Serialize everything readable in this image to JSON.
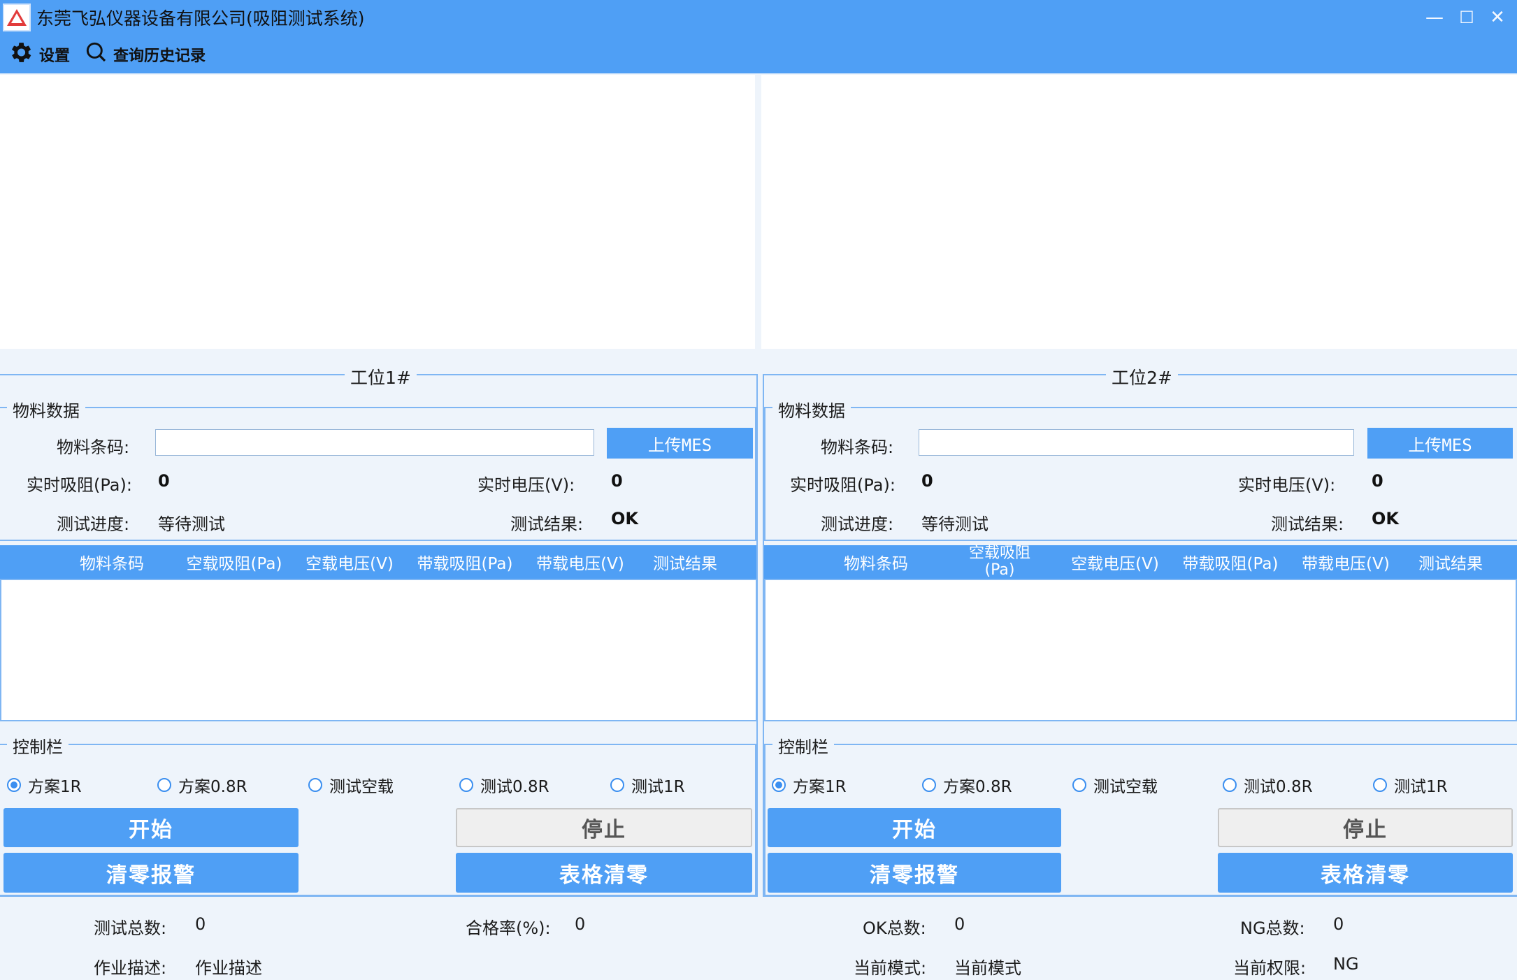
{
  "window": {
    "title": "东莞飞弘仪器设备有限公司(吸阻测试系统)",
    "minimize": "—",
    "maximize": "☐",
    "close": "✕"
  },
  "menu": [
    {
      "label": "设置",
      "icon": "gear-icon"
    },
    {
      "label": "查询历史记录",
      "icon": "search-icon"
    }
  ],
  "stations": [
    {
      "title": "工位1#",
      "material_group": "物料数据",
      "barcode_label": "物料条码:",
      "barcode_value": "",
      "upload_button": "上传MES",
      "resistance_label": "实时吸阻(Pa):",
      "resistance_value": "0",
      "voltage_label": "实时电压(V):",
      "voltage_value": "0",
      "progress_label": "测试进度:",
      "progress_value": "等待测试",
      "result_label": "测试结果:",
      "result_value": "OK",
      "table_headers": [
        "物料条码",
        "空载吸阻(Pa)",
        "空载电压(V)",
        "带载吸阻(Pa)",
        "带载电压(V)",
        "测试结果"
      ],
      "control_group": "控制栏",
      "radios": [
        {
          "label": "方案1R",
          "checked": true
        },
        {
          "label": "方案0.8R",
          "checked": false
        },
        {
          "label": "测试空载",
          "checked": false
        },
        {
          "label": "测试0.8R",
          "checked": false
        },
        {
          "label": "测试1R",
          "checked": false
        }
      ],
      "start_button": "开始",
      "stop_button": "停止",
      "clear_alarm_button": "清零报警",
      "clear_table_button": "表格清零"
    },
    {
      "title": "工位2#",
      "material_group": "物料数据",
      "barcode_label": "物料条码:",
      "barcode_value": "",
      "upload_button": "上传MES",
      "resistance_label": "实时吸阻(Pa):",
      "resistance_value": "0",
      "voltage_label": "实时电压(V):",
      "voltage_value": "0",
      "progress_label": "测试进度:",
      "progress_value": "等待测试",
      "result_label": "测试结果:",
      "result_value": "OK",
      "table_headers": [
        "物料条码",
        "空载吸阻(Pa)",
        "空载电压(V)",
        "带载吸阻(Pa)",
        "带载电压(V)",
        "测试结果"
      ],
      "control_group": "控制栏",
      "radios": [
        {
          "label": "方案1R",
          "checked": true
        },
        {
          "label": "方案0.8R",
          "checked": false
        },
        {
          "label": "测试空载",
          "checked": false
        },
        {
          "label": "测试0.8R",
          "checked": false
        },
        {
          "label": "测试1R",
          "checked": false
        }
      ],
      "start_button": "开始",
      "stop_button": "停止",
      "clear_alarm_button": "清零报警",
      "clear_table_button": "表格清零"
    }
  ],
  "stats": {
    "total_label": "测试总数:",
    "total_value": "0",
    "pass_rate_label": "合格率(%):",
    "pass_rate_value": "0",
    "ok_label": "OK总数:",
    "ok_value": "0",
    "ng_label": "NG总数:",
    "ng_value": "0",
    "job_label": "作业描述:",
    "job_value": "作业描述",
    "mode_label": "当前模式:",
    "mode_value": "当前模式",
    "permission_label": "当前权限:",
    "permission_value": "NG"
  },
  "colors": {
    "accent": "#4f9ff5",
    "background": "#eef4fb",
    "border": "#7fb6f3"
  }
}
